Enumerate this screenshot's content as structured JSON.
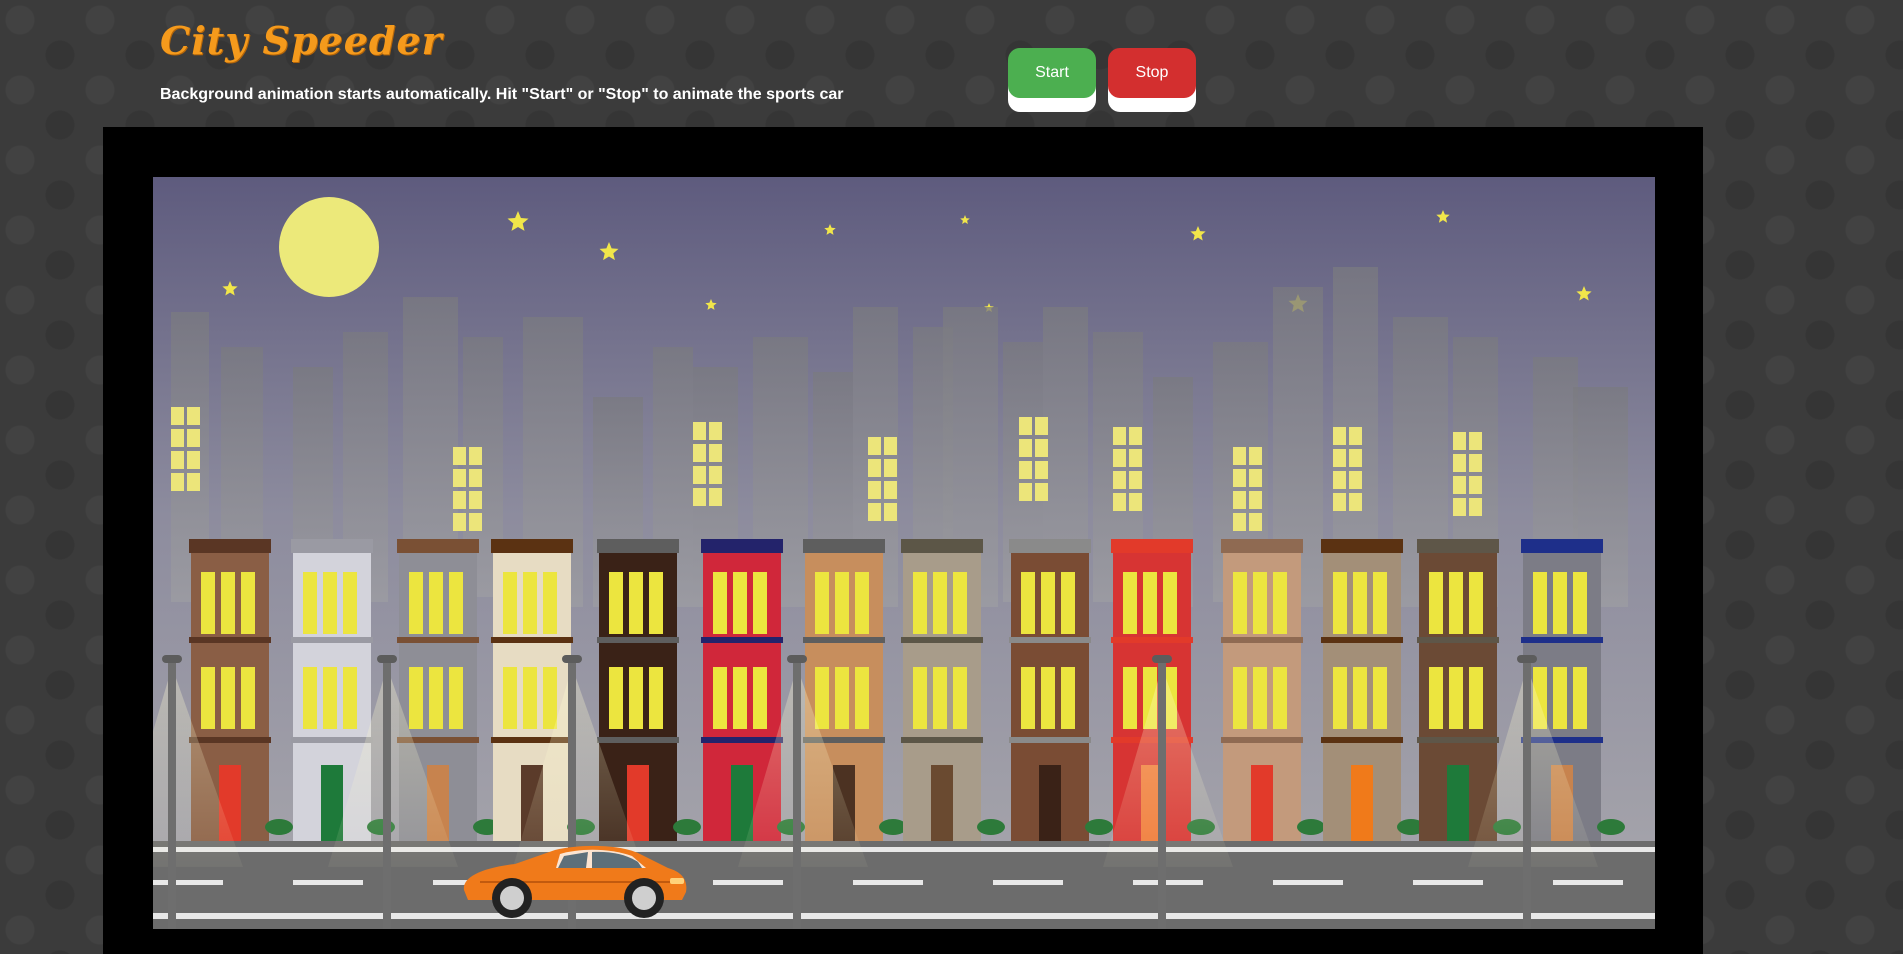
{
  "header": {
    "title": "City Speeder",
    "subtitle": "Background animation starts automatically. Hit \"Start\" or \"Stop\" to animate the sports car"
  },
  "controls": {
    "start_label": "Start",
    "stop_label": "Stop"
  },
  "colors": {
    "title": "#f59a1c",
    "start_button": "#4caf50",
    "stop_button": "#d32f2f",
    "car": "#f07a1a",
    "sky_top": "#5e5b7e",
    "moon": "#ece97a",
    "window_lit": "#ece53f"
  },
  "scene": {
    "elements": [
      "moon",
      "stars",
      "skyline",
      "townhouses",
      "street-lamps",
      "road",
      "sports-car"
    ]
  }
}
